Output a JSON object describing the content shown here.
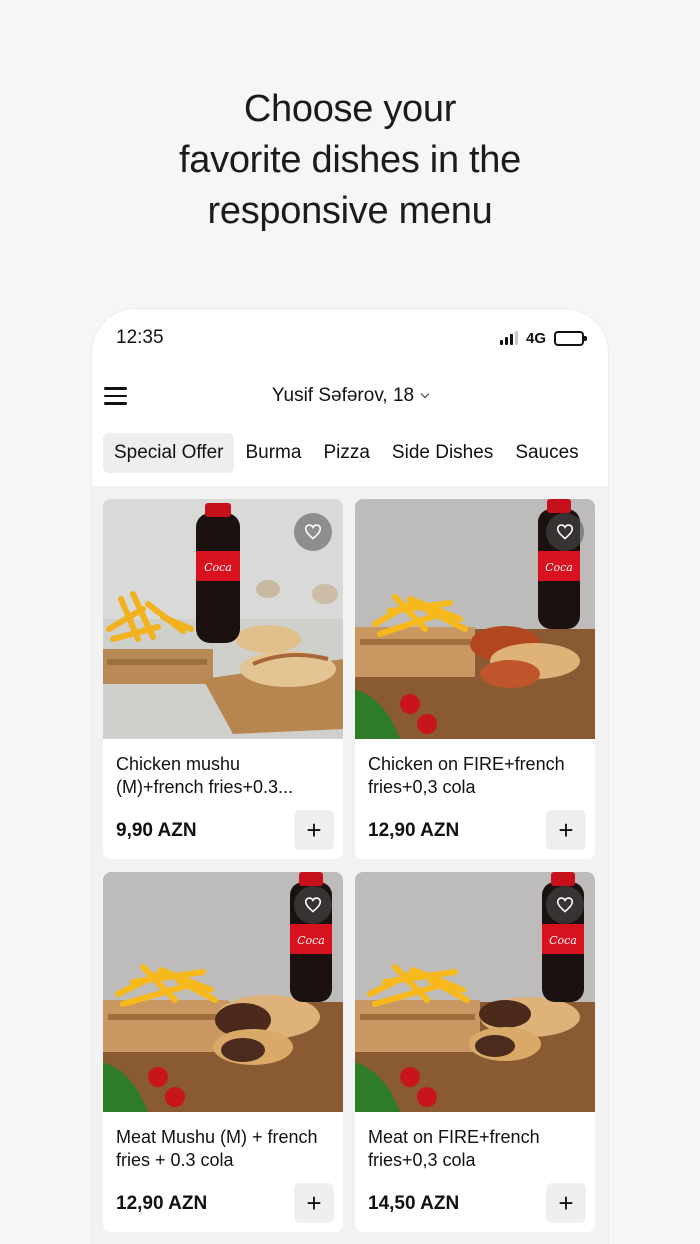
{
  "headline": {
    "line1": "Choose your",
    "line2": "favorite dishes in the",
    "line3": "responsive menu"
  },
  "status_bar": {
    "time": "12:35",
    "network": "4G",
    "signal_bars_active": 3,
    "battery_level": 1.0
  },
  "nav": {
    "menu_icon": "hamburger-icon",
    "address": "Yusif Səfərov, 18",
    "address_icon": "chevron-down-icon"
  },
  "tabs": [
    {
      "label": "Special Offer",
      "active": true
    },
    {
      "label": "Burma",
      "active": false
    },
    {
      "label": "Pizza",
      "active": false
    },
    {
      "label": "Side Dishes",
      "active": false
    },
    {
      "label": "Sauces",
      "active": false
    }
  ],
  "products": [
    {
      "title": "Chicken mushu (M)+french fries+0.3...",
      "price": "9,90 AZN",
      "add_label": "+",
      "favorite_icon": "heart-icon"
    },
    {
      "title": "Chicken on FIRE+french fries+0,3 cola",
      "price": "12,90 AZN",
      "add_label": "+",
      "favorite_icon": "heart-icon"
    },
    {
      "title": "Meat Mushu (M) + french fries + 0.3 cola",
      "price": "12,90 AZN",
      "add_label": "+",
      "favorite_icon": "heart-icon"
    },
    {
      "title": "Meat on FIRE+french fries+0,3 cola",
      "price": "14,50 AZN",
      "add_label": "+",
      "favorite_icon": "heart-icon"
    }
  ],
  "colors": {
    "page_bg": "#f6f6f6",
    "card_bg": "#ffffff",
    "active_tab_bg": "#eeeeee",
    "add_button_bg": "#efefef",
    "text": "#111111"
  }
}
